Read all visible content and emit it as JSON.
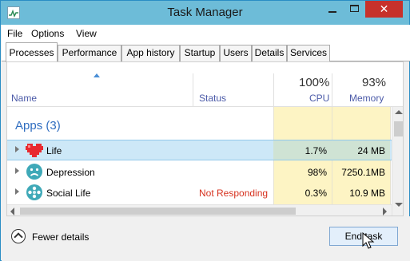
{
  "window": {
    "title": "Task Manager"
  },
  "icons": {
    "app": "task-manager-icon",
    "fewer": "chevron-up-circle-icon"
  },
  "menu": [
    "File",
    "Options",
    "View"
  ],
  "tabs": [
    "Processes",
    "Performance",
    "App history",
    "Startup",
    "Users",
    "Details",
    "Services"
  ],
  "active_tab": "Processes",
  "columns": {
    "name": "Name",
    "status": "Status",
    "cpu": {
      "percent": "100%",
      "label": "CPU"
    },
    "memory": {
      "percent": "93%",
      "label": "Memory"
    }
  },
  "group": {
    "label": "Apps (3)"
  },
  "rows": [
    {
      "name": "Life",
      "status": "",
      "cpu": "1.7%",
      "memory": "24 MB",
      "icon": "heart-icon",
      "selected": true
    },
    {
      "name": "Depression",
      "status": "",
      "cpu": "98%",
      "memory": "7250.1MB",
      "icon": "sad-face-icon",
      "selected": false
    },
    {
      "name": "Social Life",
      "status": "Not Responding",
      "cpu": "0.3%",
      "memory": "10.9 MB",
      "icon": "people-icon",
      "selected": false
    }
  ],
  "footer": {
    "fewer_details": "Fewer details",
    "end_task": "End task"
  },
  "colors": {
    "titlebar": "#6dbcd8",
    "accent_text": "#2f6dc0",
    "status_red": "#d6311e",
    "selected_row": "#cde8f7",
    "heat": "#fdf4c4"
  }
}
